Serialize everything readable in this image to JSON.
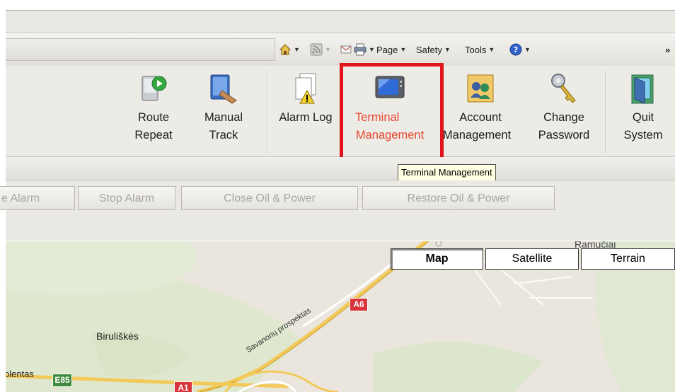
{
  "toolbar": {
    "page": "Page",
    "safety": "Safety",
    "tools": "Tools",
    "overflow": "»"
  },
  "ribbon": {
    "route_repeat": [
      "Route",
      "Repeat"
    ],
    "manual_track": [
      "Manual",
      "Track"
    ],
    "alarm_log": "Alarm Log",
    "terminal_management": [
      "Terminal",
      "Management"
    ],
    "account_management": [
      "Account",
      "Management"
    ],
    "change_password": [
      "Change",
      "Password"
    ],
    "quit_system": [
      "Quit",
      "System"
    ]
  },
  "tooltip": "Terminal Management",
  "action_buttons": {
    "release_alarm": "e Alarm",
    "stop_alarm": "Stop Alarm",
    "close_oil_power": "Close Oil & Power",
    "restore_oil_power": "Restore Oil & Power"
  },
  "map": {
    "types": [
      "Map",
      "Satellite",
      "Terrain"
    ],
    "selected": "Map",
    "labels": {
      "ramuciai": "Ramučiai",
      "biruliskes": "Biruliškės",
      "plentas": "plentas",
      "savanoriu": "Savanorių prospektas",
      "a6": "A6",
      "a1": "A1",
      "e85": "E85"
    }
  },
  "colors": {
    "highlight": "#e3131b",
    "active_text": "#e8472f",
    "road_shield": "#d9343b",
    "road_shield_green": "#3d8a3d"
  }
}
